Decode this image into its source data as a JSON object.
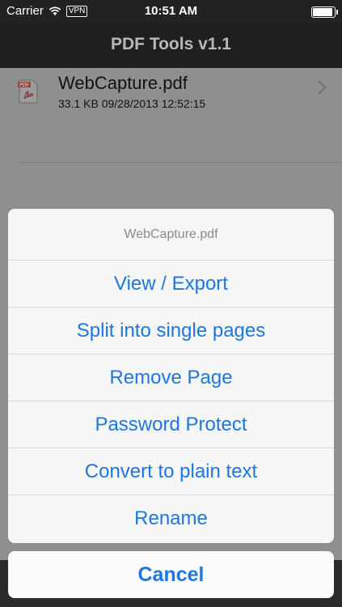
{
  "status_bar": {
    "carrier": "Carrier",
    "wifi_icon": "wifi-icon",
    "vpn": "VPN",
    "time": "10:51 AM",
    "battery_level": 0.95
  },
  "nav": {
    "title": "PDF Tools v1.1"
  },
  "files": [
    {
      "name": "WebCapture.pdf",
      "meta": "33.1 KB  09/28/2013 12:52:15",
      "icon": "pdf-file-icon"
    }
  ],
  "action_sheet": {
    "title": "WebCapture.pdf",
    "buttons": [
      "View / Export",
      "Split into single pages",
      "Remove Page",
      "Password Protect",
      "Convert to plain text",
      "Rename"
    ],
    "cancel": "Cancel"
  },
  "colors": {
    "accent": "#1d77e0",
    "nav_bg": "#1f1f1f"
  }
}
